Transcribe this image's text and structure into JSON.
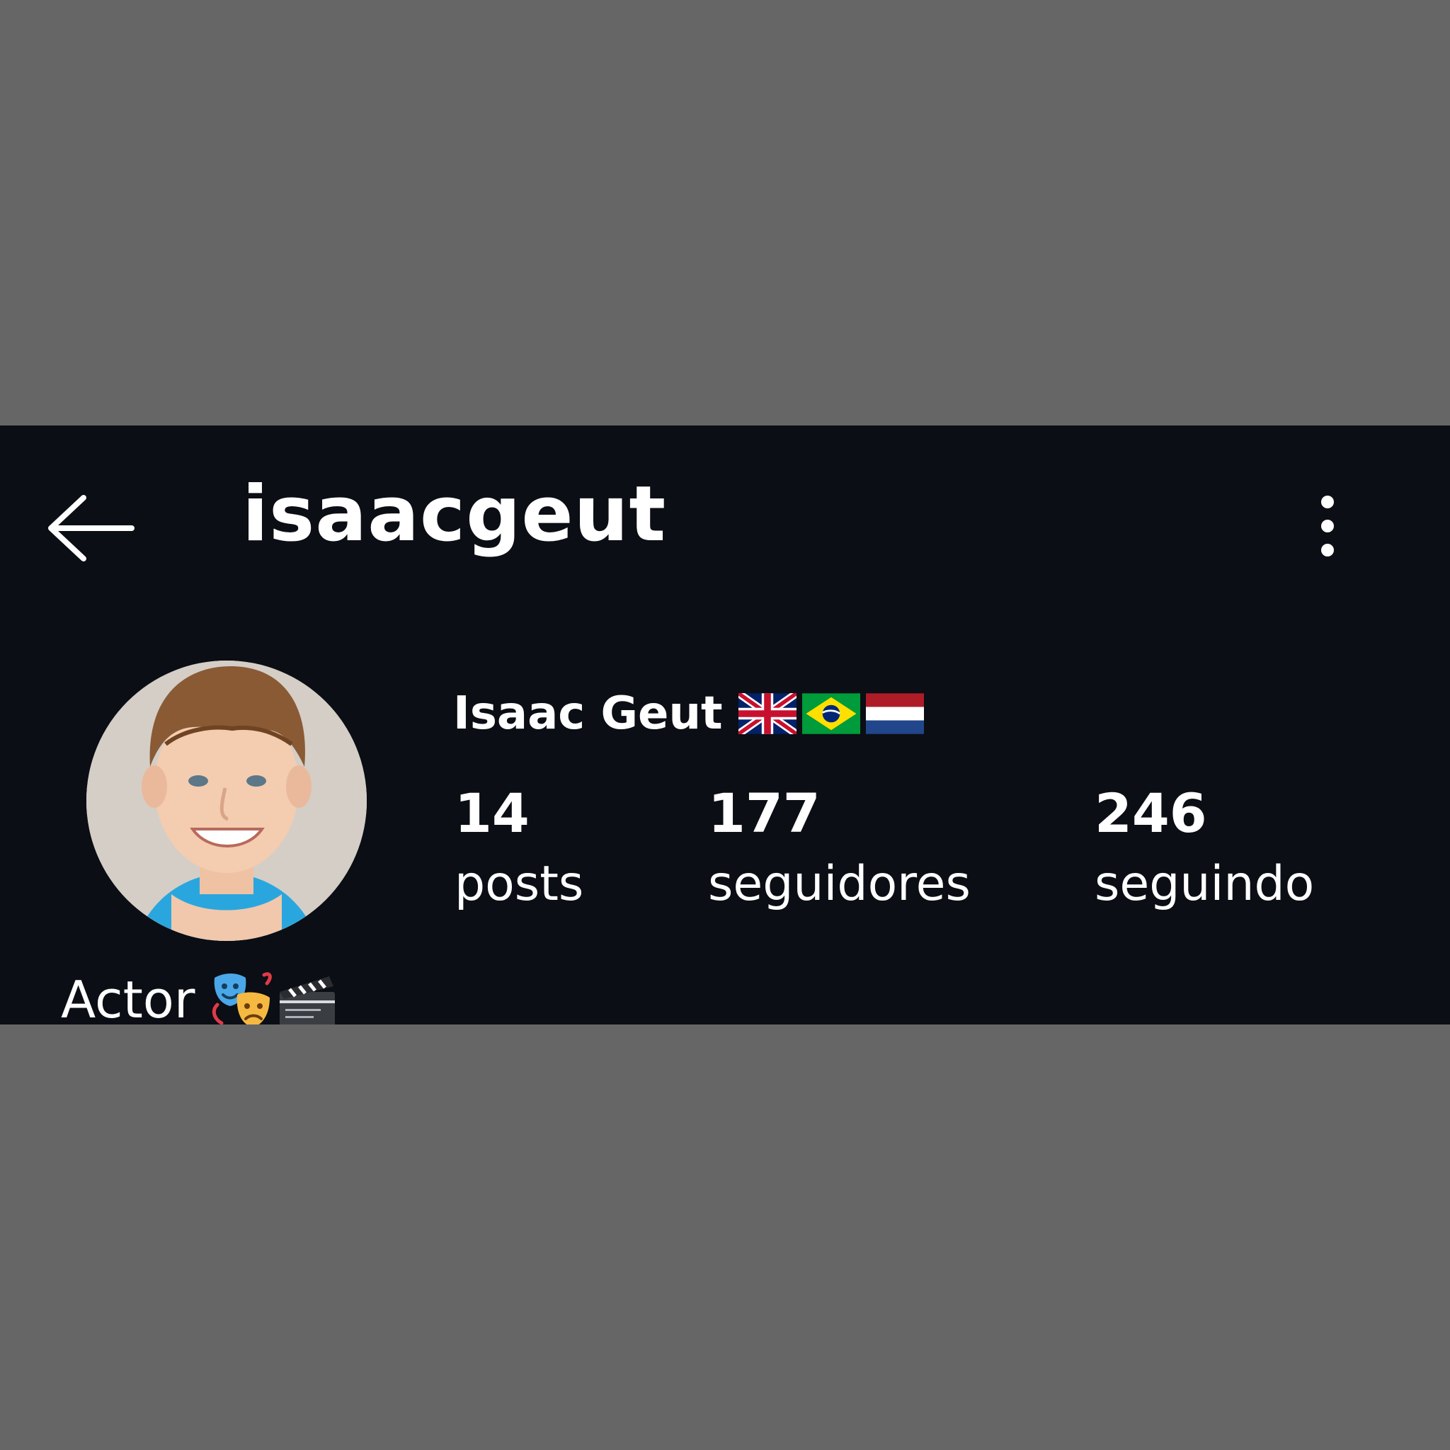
{
  "header": {
    "username": "isaacgeut",
    "back_icon": "arrow-left-icon",
    "menu_icon": "more-vertical-icon"
  },
  "profile": {
    "display_name": "Isaac Geut",
    "flags": [
      "united-kingdom-flag",
      "brazil-flag",
      "netherlands-flag"
    ],
    "avatar": "profile-photo",
    "bio": "Actor",
    "bio_emoji": [
      "performing-arts-icon",
      "clapper-board-icon"
    ]
  },
  "stats": {
    "posts_count": "14",
    "posts_label": "posts",
    "followers_count": "177",
    "followers_label": "seguidores",
    "following_count": "246",
    "following_label": "seguindo"
  },
  "colors": {
    "background": "#0b0e14",
    "surround": "#666666",
    "text": "#ffffff"
  }
}
